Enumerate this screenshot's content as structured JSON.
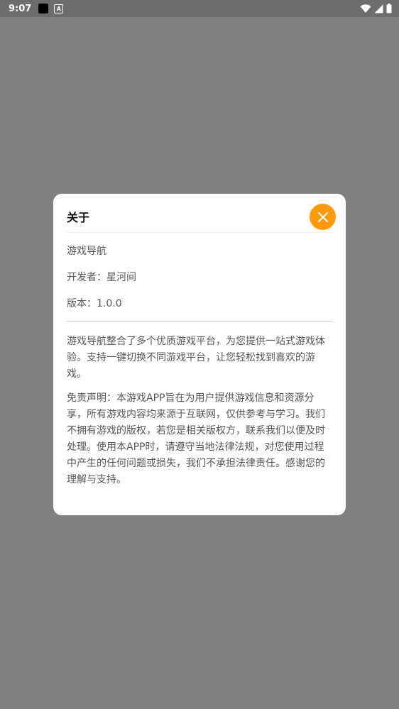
{
  "status_bar": {
    "time": "9:07",
    "notification_icons": [
      "black-square-icon",
      "a-box-icon"
    ],
    "system_icons": [
      "wifi-icon",
      "cell-signal-icon",
      "battery-icon"
    ]
  },
  "dialog": {
    "title": "关于",
    "close_icon": "close-icon",
    "accent_color": "#ff9a0d",
    "app_name": "游戏导航",
    "developer": "开发者：星河间",
    "version": "版本：1.0.0",
    "description": "游戏导航整合了多个优质游戏平台，为您提供一站式游戏体验。支持一键切换不同游戏平台，让您轻松找到喜欢的游戏。",
    "disclaimer": "免责声明：本游戏APP旨在为用户提供游戏信息和资源分享，所有游戏内容均来源于互联网，仅供参考与学习。我们不拥有游戏的版权，若您是相关版权方，联系我们以便及时处理。使用本APP时，请遵守当地法律法规，对您使用过程中产生的任何问题或损失，我们不承担法律责任。感谢您的理解与支持。"
  }
}
